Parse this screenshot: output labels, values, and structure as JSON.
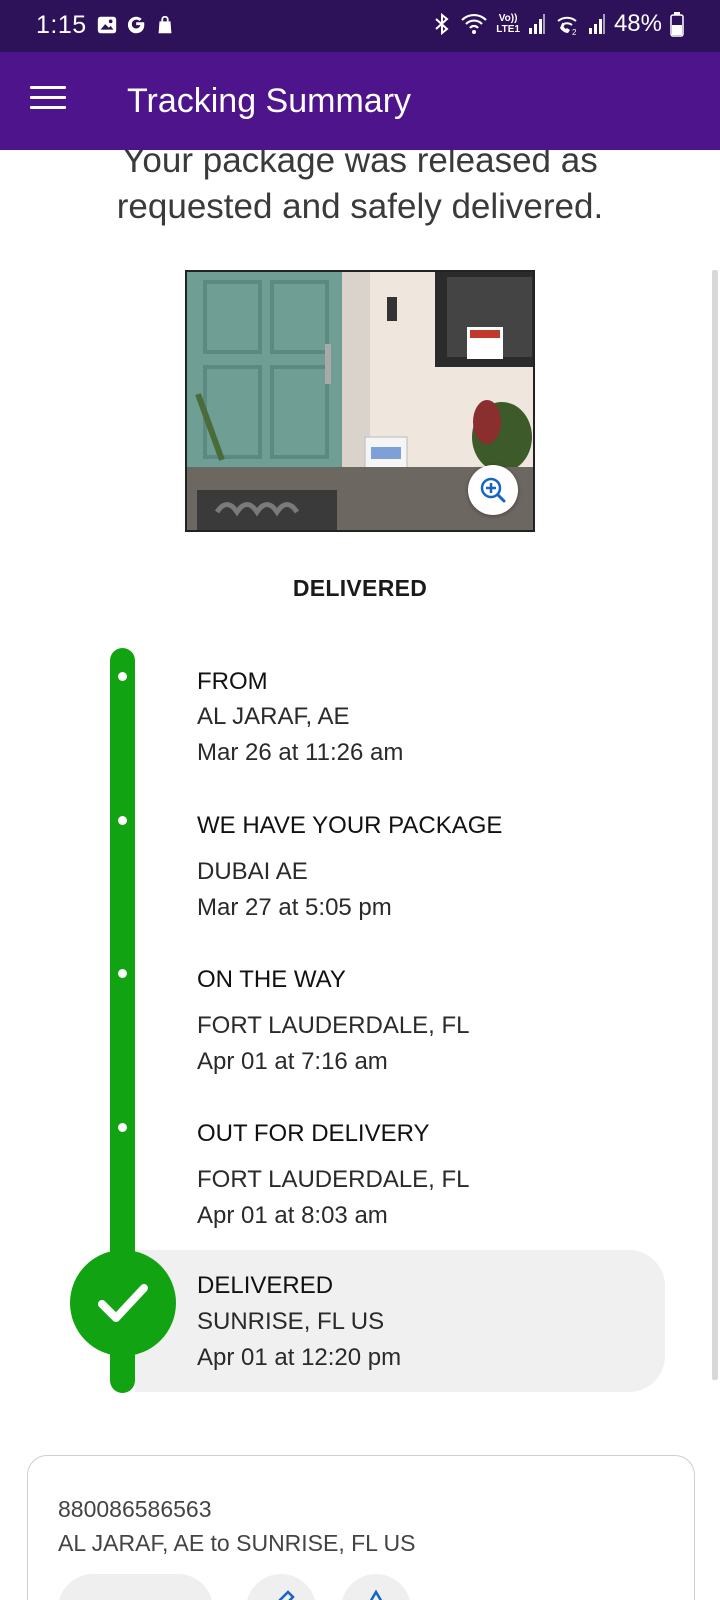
{
  "status_bar": {
    "time": "1:15",
    "battery": "48%",
    "left_icons": [
      "gallery-icon",
      "google-icon",
      "shopping-bag-icon"
    ],
    "right_icons": [
      "bluetooth-icon",
      "wifi-icon",
      "volte-lte1-icon",
      "signal-icon",
      "wifi-calling-icon",
      "signal-2-icon",
      "battery-icon"
    ],
    "volte_label": "Vo))",
    "lte_label": "LTE1"
  },
  "app_bar": {
    "title": "Tracking Summary"
  },
  "headline": {
    "line1": "Your package was released as",
    "line2": "requested and safely delivered."
  },
  "status": {
    "label": "DELIVERED"
  },
  "timeline": [
    {
      "title": "FROM",
      "location": "AL JARAF, AE",
      "time": "Mar 26 at 11:26 am"
    },
    {
      "title": "WE HAVE YOUR PACKAGE",
      "location": "DUBAI AE",
      "time": "Mar 27 at 5:05 pm"
    },
    {
      "title": "ON THE WAY",
      "location": "FORT LAUDERDALE, FL",
      "time": "Apr 01 at 7:16 am"
    },
    {
      "title": "OUT FOR DELIVERY",
      "location": "FORT LAUDERDALE, FL",
      "time": "Apr 01 at 8:03 am"
    },
    {
      "title": "DELIVERED",
      "location": "SUNRISE, FL US",
      "time": "Apr 01 at 12:20 pm"
    }
  ],
  "shipment": {
    "tracking_number": "880086586563",
    "route": "AL JARAF, AE to SUNRISE, FL US"
  },
  "colors": {
    "status_bar": "#2e1259",
    "app_bar": "#4d148c",
    "timeline_green": "#12a312",
    "current_bg": "#f0f0f0"
  }
}
